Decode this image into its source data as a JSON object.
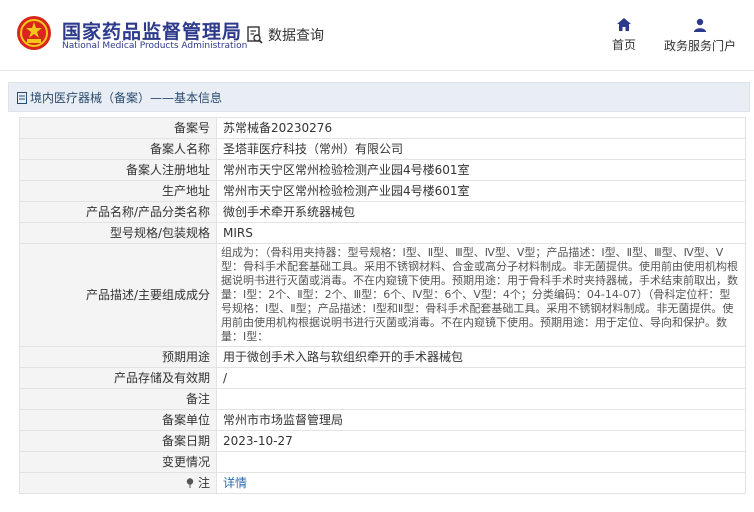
{
  "header": {
    "title": "国家药品监督管理局",
    "subtitle": "National Medical Products Administration",
    "query_label": "数据查询",
    "nav": [
      {
        "label": "首页",
        "icon": "home-icon"
      },
      {
        "label": "政务服务门户",
        "icon": "user-icon"
      }
    ]
  },
  "breadcrumb": "境内医疗器械（备案）——基本信息",
  "record": {
    "rows": [
      {
        "key": "备案号",
        "value": "苏常械备20230276"
      },
      {
        "key": "备案人名称",
        "value": "圣塔菲医疗科技（常州）有限公司"
      },
      {
        "key": "备案人注册地址",
        "value": "常州市天宁区常州检验检测产业园4号楼601室"
      },
      {
        "key": "生产地址",
        "value": "常州市天宁区常州检验检测产业园4号楼601室"
      },
      {
        "key": "产品名称/产品分类名称",
        "value": "微创手术牵开系统器械包"
      },
      {
        "key": "型号规格/包装规格",
        "value": "MIRS"
      },
      {
        "key": "产品描述/主要组成成分",
        "value": "组成为：（骨科用夹持器：型号规格：Ⅰ型、Ⅱ型、Ⅲ型、Ⅳ型、Ⅴ型；产品描述：Ⅰ型、Ⅱ型、Ⅲ型、Ⅳ型、Ⅴ型：骨科手术配套基础工具。采用不锈钢材料、合金或高分子材料制成。非无菌提供。使用前由使用机构根据说明书进行灭菌或消毒。不在内窥镜下使用。预期用途：用于骨科手术时夹持器械，手术结束前取出，数量：Ⅰ型：2个、Ⅱ型：2个、Ⅲ型：6个、Ⅳ型：6个、Ⅴ型：4个；分类编码：04-14-07）（骨科定位杆：型号规格：Ⅰ型、Ⅱ型；产品描述：Ⅰ型和Ⅱ型：骨科手术配套基础工具。采用不锈钢材料制成。非无菌提供。使用前由使用机构根据说明书进行灭菌或消毒。不在内窥镜下使用。预期用途：用于定位、导向和保护。数量：Ⅰ型："
      },
      {
        "key": "预期用途",
        "value": "用于微创手术入路与软组织牵开的手术器械包"
      },
      {
        "key": "产品存储及有效期",
        "value": "/"
      },
      {
        "key": "备注",
        "value": ""
      },
      {
        "key": "备案单位",
        "value": "常州市市场监督管理局"
      },
      {
        "key": "备案日期",
        "value": "2023-10-27"
      },
      {
        "key": "变更情况",
        "value": ""
      },
      {
        "key": "注",
        "value": "详情"
      }
    ]
  },
  "colors": {
    "brand": "#2d3a8c",
    "link": "#2b6cb0",
    "emblem": "#d9261c"
  }
}
